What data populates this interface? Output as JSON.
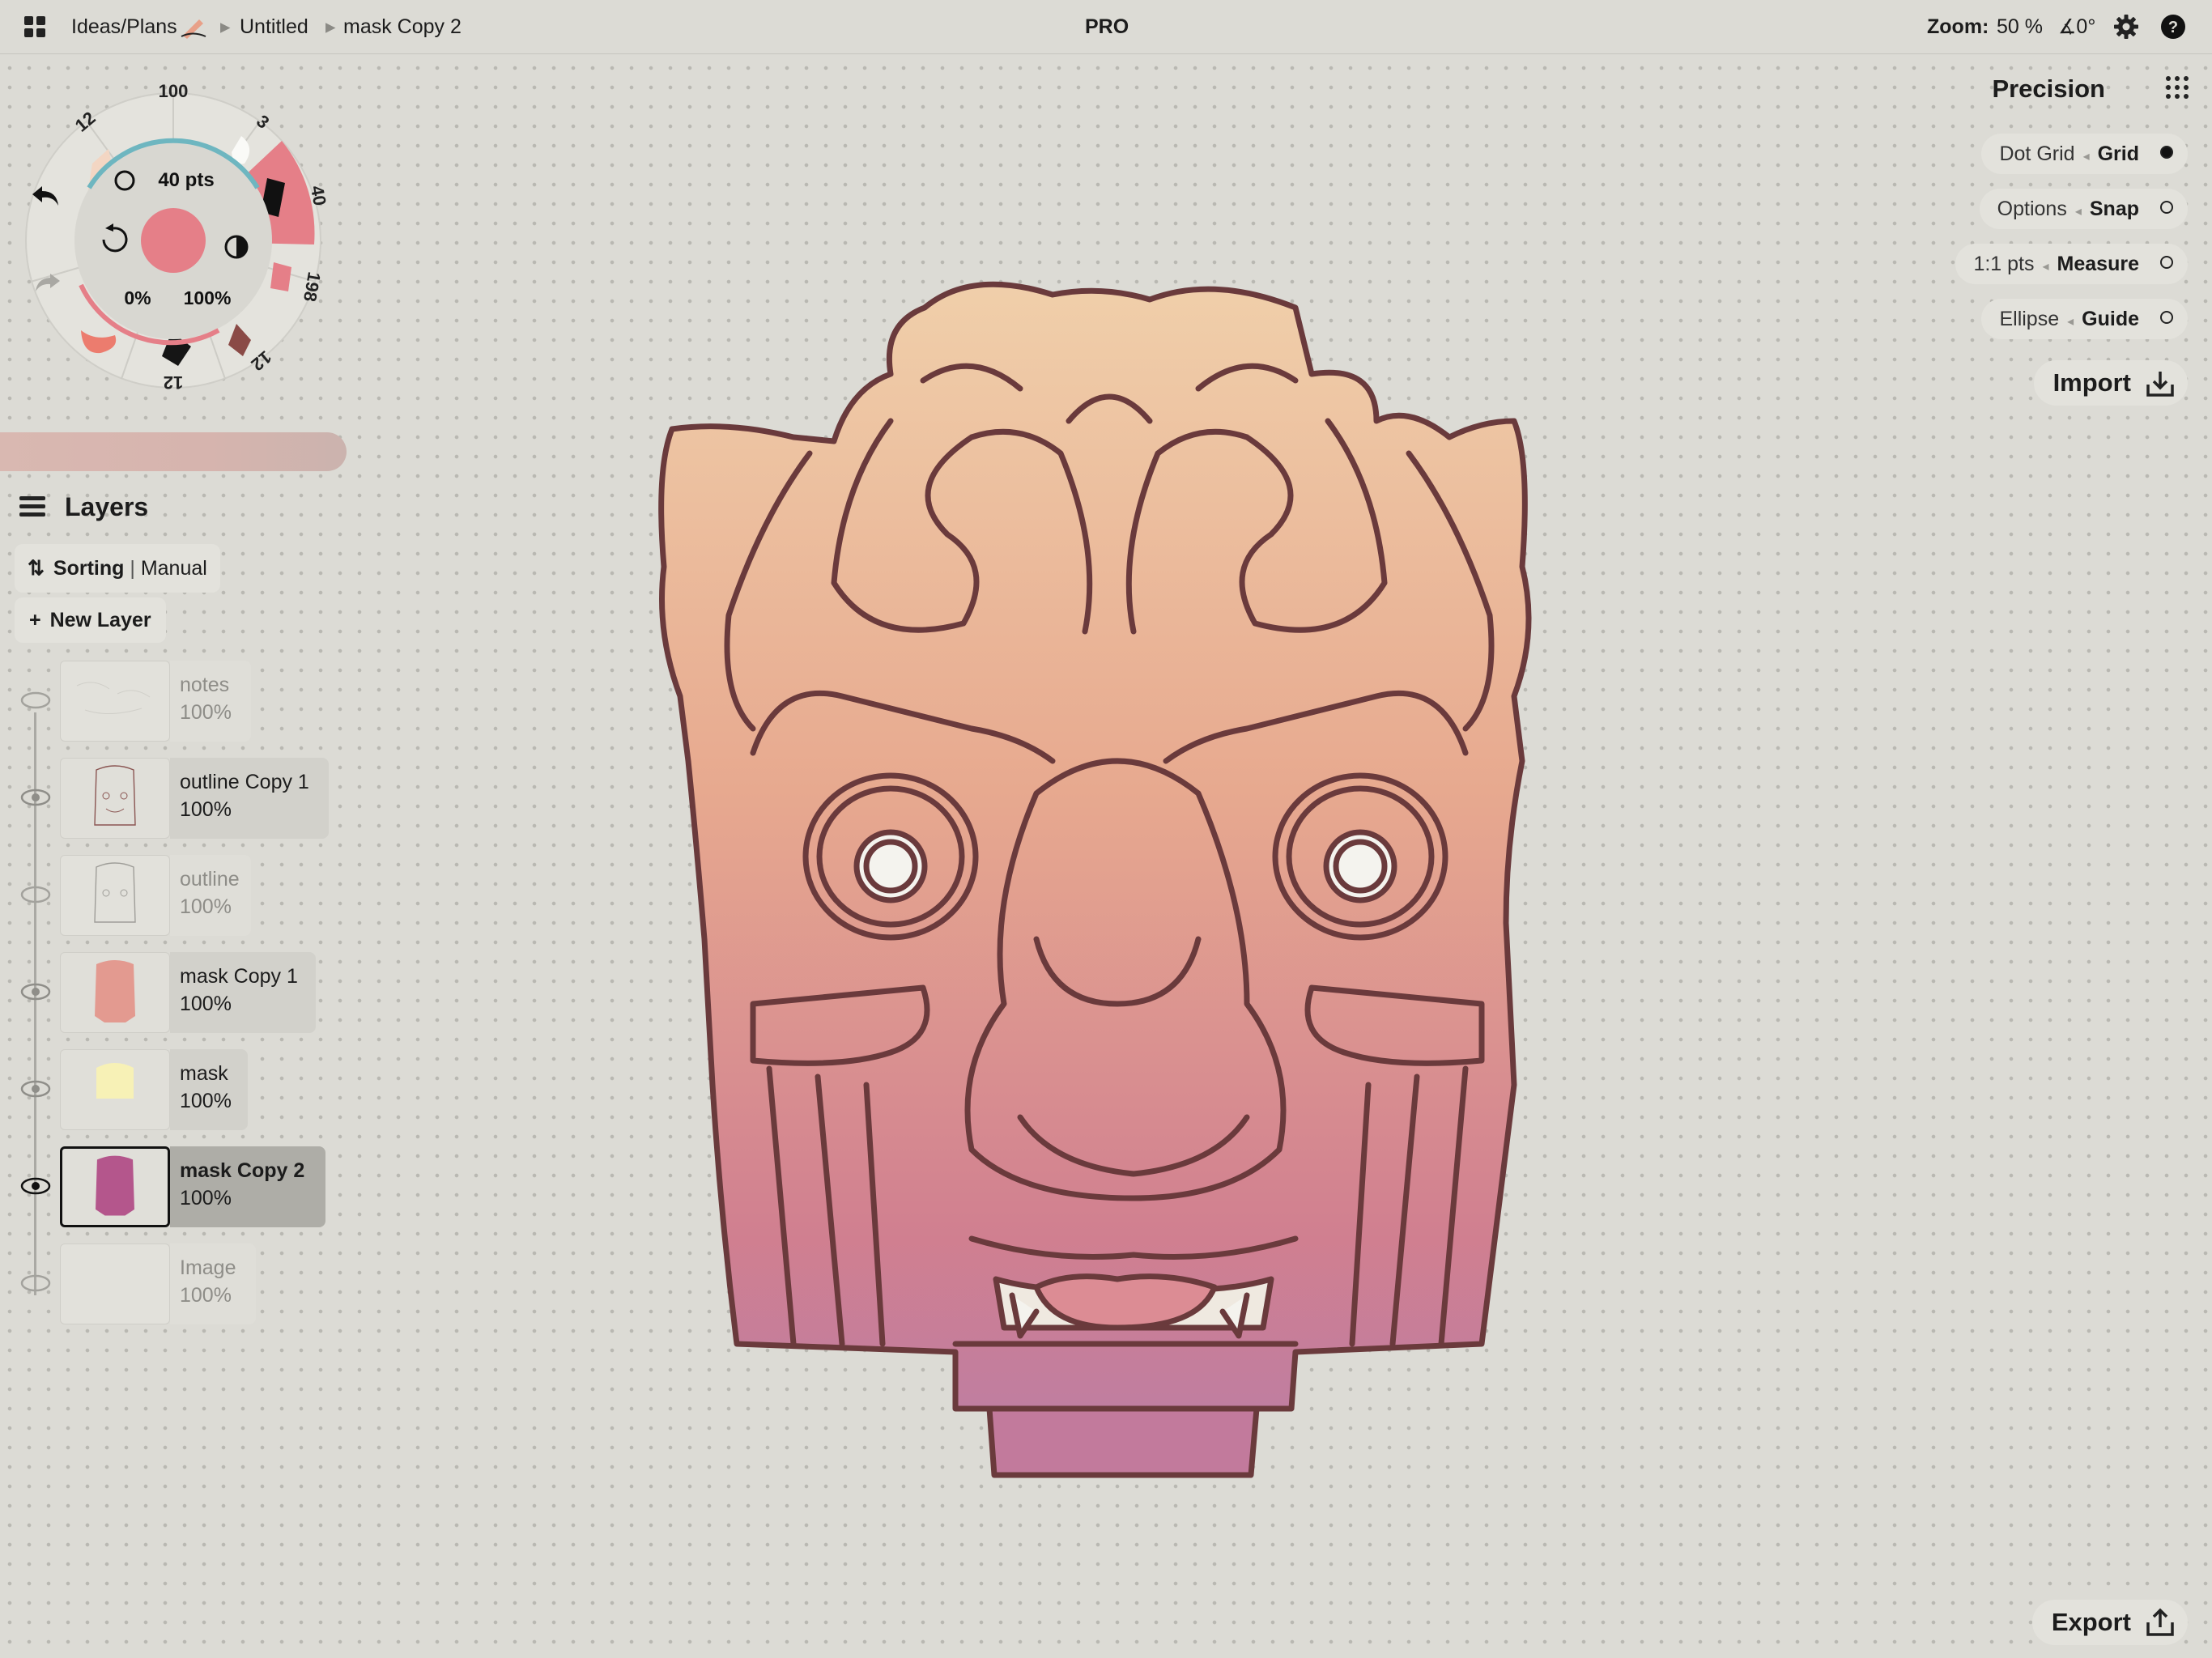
{
  "topbar": {
    "grid_icon": "grid-apps-icon",
    "breadcrumb": [
      "Ideas/Plans",
      "Untitled",
      "mask Copy 2"
    ],
    "center": "PRO",
    "zoom_label": "Zoom:",
    "zoom_value": "50 %",
    "angle": "∡0°"
  },
  "precision": {
    "title": "Precision",
    "options": [
      {
        "left": "Dot Grid",
        "right": "Grid",
        "on": true
      },
      {
        "left": "Options",
        "right": "Snap",
        "on": false
      },
      {
        "left": "1:1 pts",
        "right": "Measure",
        "on": false
      },
      {
        "left": "Ellipse",
        "right": "Guide",
        "on": false
      }
    ],
    "import": "Import",
    "export": "Export"
  },
  "tool_wheel": {
    "size": "40 pts",
    "smoothing": "0%",
    "opacity": "100%",
    "color": "#e57f88",
    "tools": [
      {
        "label": "12"
      },
      {
        "label": "100"
      },
      {
        "label": "3"
      },
      {
        "label": "40"
      },
      {
        "label": "198"
      },
      {
        "label": "12"
      },
      {
        "label": "12"
      }
    ]
  },
  "layers": {
    "title": "Layers",
    "sorting_label": "Sorting",
    "sorting_value": "Manual",
    "new_layer": "New Layer",
    "items": [
      {
        "name": "notes",
        "opacity": "100%",
        "visible": false,
        "selected": false
      },
      {
        "name": "outline Copy 1",
        "opacity": "100%",
        "visible": true,
        "selected": false
      },
      {
        "name": "outline",
        "opacity": "100%",
        "visible": false,
        "selected": false
      },
      {
        "name": "mask Copy 1",
        "opacity": "100%",
        "visible": true,
        "selected": false
      },
      {
        "name": "mask",
        "opacity": "100%",
        "visible": true,
        "selected": false
      },
      {
        "name": "mask Copy 2",
        "opacity": "100%",
        "visible": true,
        "selected": true
      },
      {
        "name": "Image",
        "opacity": "100%",
        "visible": false,
        "selected": false
      }
    ]
  }
}
